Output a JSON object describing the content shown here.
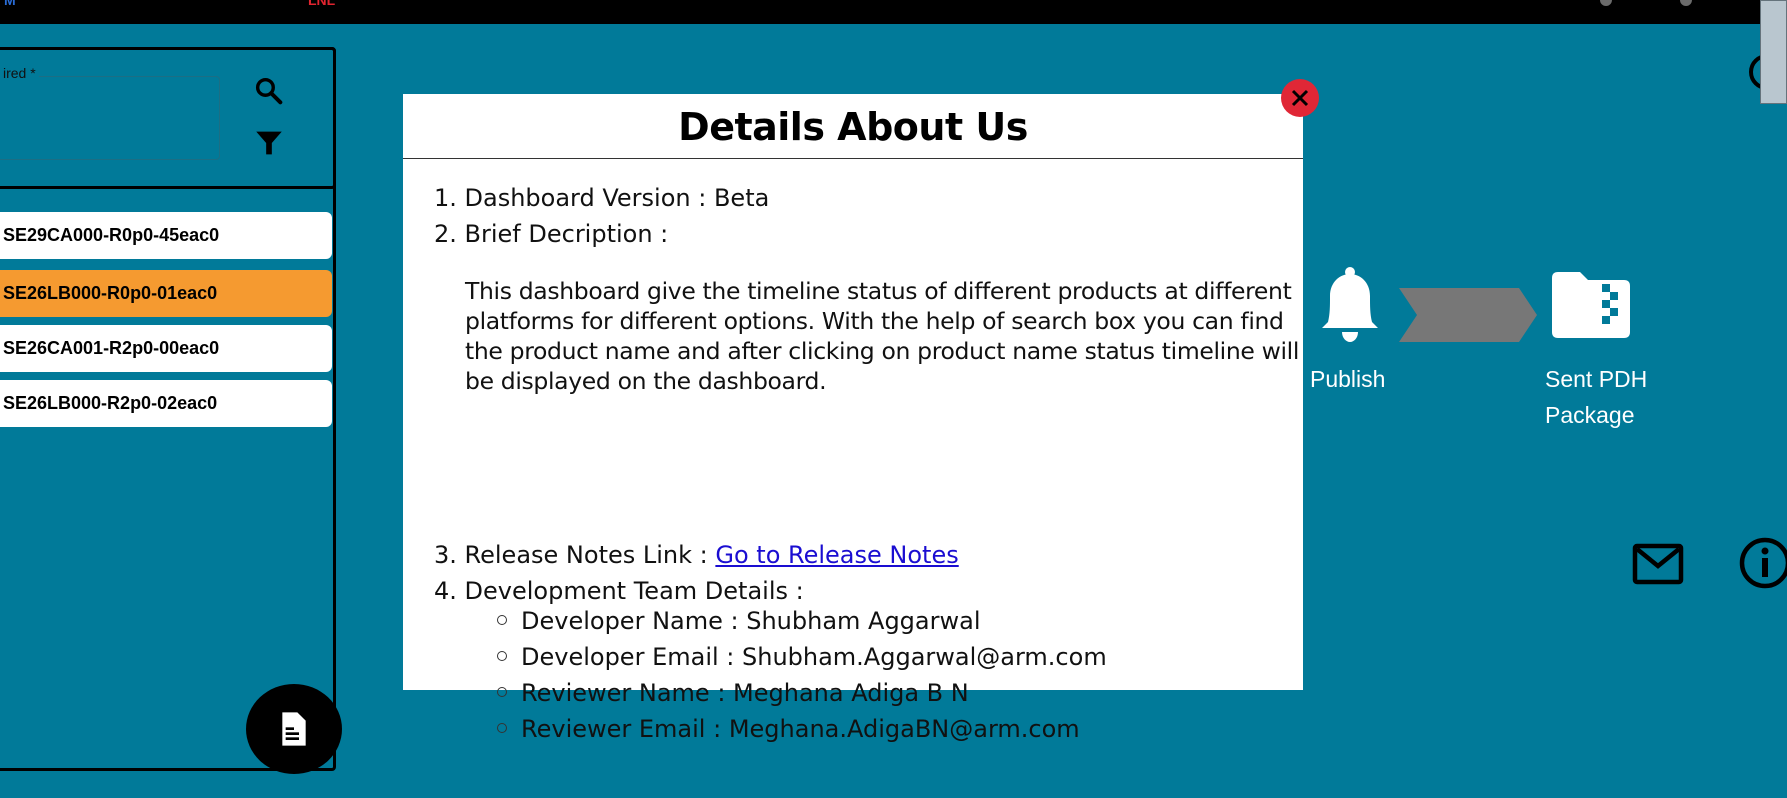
{
  "topbar": {
    "brand": "M",
    "brand_red": "LNL"
  },
  "search": {
    "legend": "ired *",
    "search_icon": "search-icon",
    "filter_icon": "filter-icon"
  },
  "products": [
    "SE29CA000-R0p0-45eac0",
    "SE26LB000-R0p0-01eac0",
    "SE26CA001-R2p0-00eac0",
    "SE26LB000-R2p0-02eac0"
  ],
  "active_product_index": 1,
  "timeline": {
    "publish_label": "Publish",
    "sent_label": "Sent PDH Package"
  },
  "modal": {
    "title": "Details About Us",
    "item1": "1. Dashboard Version : Beta",
    "item2": "2. Brief Decription :",
    "description": "This dashboard give the timeline status of different products at different platforms for different options. With the help of search box you can find the product name and after clicking on product name status timeline will be displayed on the dashboard.",
    "item3_prefix": "3. Release Notes Link : ",
    "item3_link": "Go to Release Notes",
    "item4": "4. Development Team Details :",
    "team": [
      "Developer Name : Shubham Aggarwal",
      "Developer Email : Shubham.Aggarwal@arm.com",
      "Reviewer Name : Meghana Adiga B N",
      "Reviewer Email : Meghana.AdigaBN@arm.com"
    ]
  },
  "colors": {
    "background": "#017a99",
    "active_item": "#f59a30",
    "close_button": "#e02736",
    "link": "#1a0dd1"
  }
}
